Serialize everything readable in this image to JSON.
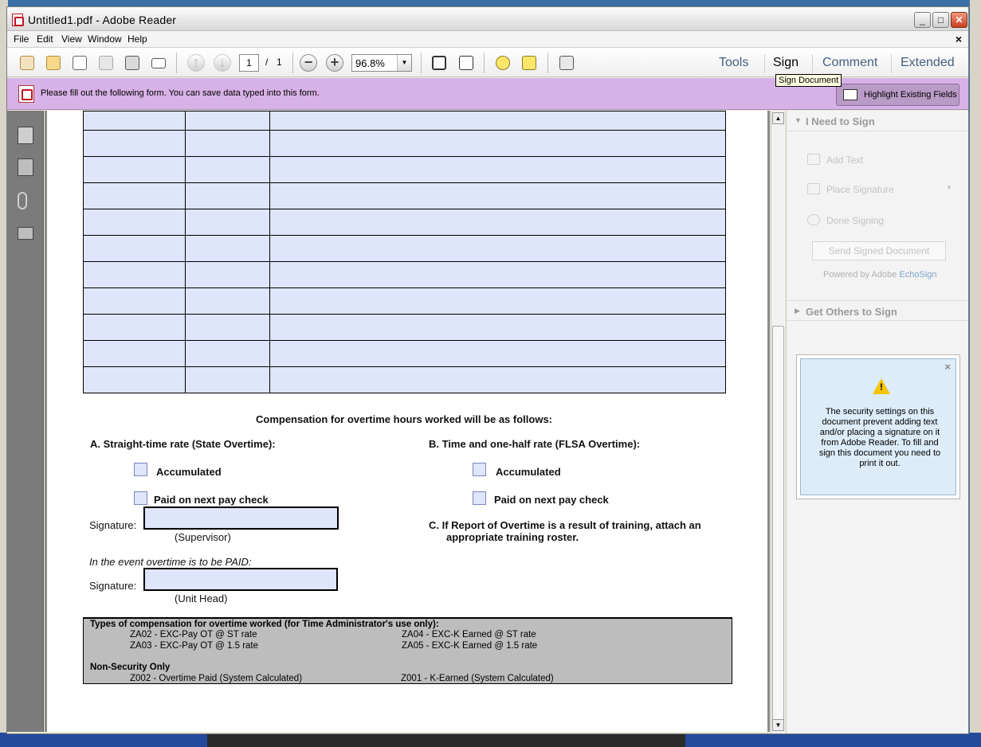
{
  "window": {
    "title": "Untitled1.pdf - Adobe Reader",
    "minimize_label": "_",
    "maximize_label": "□",
    "close_label": "✕"
  },
  "menu": {
    "items": [
      "File",
      "Edit",
      "View",
      "Window",
      "Help"
    ],
    "doc_close": "×"
  },
  "toolbar": {
    "page_current": "1",
    "page_sep": "/",
    "page_total": "1",
    "zoom": "96.8%",
    "zoom_out": "−",
    "zoom_in": "+",
    "tabs": [
      "Tools",
      "Sign",
      "Comment",
      "Extended"
    ],
    "tooltip": "Sign Document"
  },
  "formbar": {
    "message": "Please fill out the following form. You can save data typed into this form.",
    "highlight_button": "Highlight Existing Fields"
  },
  "form": {
    "rows": 11,
    "heading": "Compensation for overtime hours worked will be as follows:",
    "section_a": {
      "label": "A.  Straight-time rate (State Overtime):",
      "opt1": "Accumulated",
      "opt2": "Paid on next pay check"
    },
    "section_b": {
      "label": "B.  Time and one-half rate (FLSA Overtime):",
      "opt1": "Accumulated",
      "opt2": "Paid on next pay check"
    },
    "signature_label": "Signature:",
    "supervisor": "(Supervisor)",
    "section_c_line1": "C.   If Report of Overtime is a result of training, attach an",
    "section_c_line2": "appropriate training roster.",
    "paid_note": "In the event overtime is to be PAID:",
    "unit_head": "(Unit Head)",
    "types": {
      "title": "Types of compensation for overtime worked (for Time Administrator's use only):",
      "za02": "ZA02 - EXC-Pay OT @ ST rate",
      "za03": "ZA03 - EXC-Pay OT @ 1.5 rate",
      "za04": "ZA04 - EXC-K Earned @ ST rate",
      "za05": "ZA05 - EXC-K Earned @ 1.5 rate",
      "non_security": "Non-Security Only",
      "z002": "Z002 - Overtime Paid (System Calculated)",
      "z001": "Z001 - K-Earned (System Calculated)"
    }
  },
  "panel": {
    "need_to_sign": "I Need to Sign",
    "add_text": "Add Text",
    "place_signature": "Place Signature",
    "done_signing": "Done Signing",
    "send_signed": "Send Signed Document",
    "powered_prefix": "Powered by Adobe",
    "powered_brand": "EchoSign",
    "get_others": "Get Others to Sign",
    "security_note": "The security settings on this document prevent adding text and/or placing a signature on it from Adobe Reader. To fill and sign this document you need to print it out.",
    "note_close": "×",
    "warn_mark": "!"
  },
  "icons": [
    "pdf-icon",
    "create-icon",
    "open-icon",
    "edit-icon",
    "save-icon",
    "print-icon",
    "email-icon",
    "prev-page-icon",
    "next-page-icon",
    "fit-page-icon",
    "fit-width-icon",
    "comment-icon",
    "highlight-icon",
    "fullscreen-icon",
    "pages-icon",
    "layers-icon",
    "attachment-icon",
    "signatures-icon",
    "warning-icon"
  ]
}
